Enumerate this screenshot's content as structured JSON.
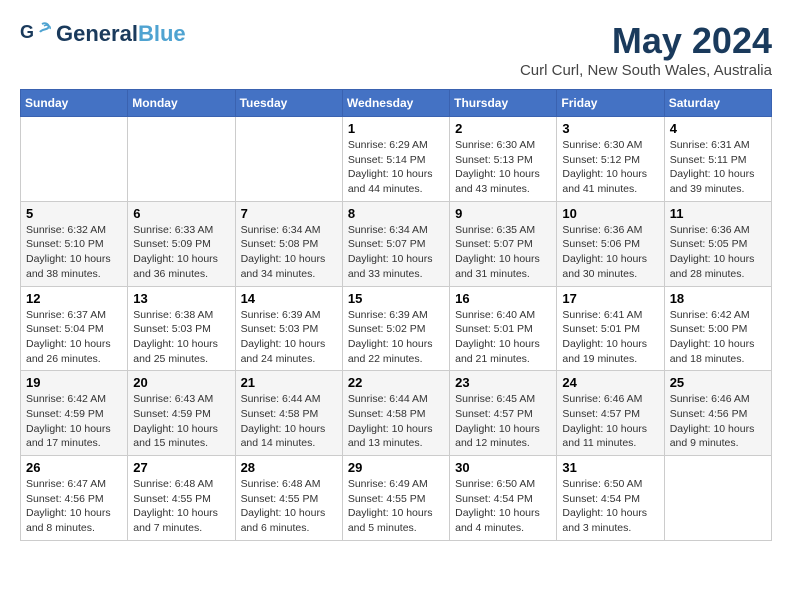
{
  "header": {
    "logo_general": "General",
    "logo_blue": "Blue",
    "month_title": "May 2024",
    "location": "Curl Curl, New South Wales, Australia"
  },
  "weekdays": [
    "Sunday",
    "Monday",
    "Tuesday",
    "Wednesday",
    "Thursday",
    "Friday",
    "Saturday"
  ],
  "weeks": [
    [
      {
        "day": "",
        "info": ""
      },
      {
        "day": "",
        "info": ""
      },
      {
        "day": "",
        "info": ""
      },
      {
        "day": "1",
        "info": "Sunrise: 6:29 AM\nSunset: 5:14 PM\nDaylight: 10 hours\nand 44 minutes."
      },
      {
        "day": "2",
        "info": "Sunrise: 6:30 AM\nSunset: 5:13 PM\nDaylight: 10 hours\nand 43 minutes."
      },
      {
        "day": "3",
        "info": "Sunrise: 6:30 AM\nSunset: 5:12 PM\nDaylight: 10 hours\nand 41 minutes."
      },
      {
        "day": "4",
        "info": "Sunrise: 6:31 AM\nSunset: 5:11 PM\nDaylight: 10 hours\nand 39 minutes."
      }
    ],
    [
      {
        "day": "5",
        "info": "Sunrise: 6:32 AM\nSunset: 5:10 PM\nDaylight: 10 hours\nand 38 minutes."
      },
      {
        "day": "6",
        "info": "Sunrise: 6:33 AM\nSunset: 5:09 PM\nDaylight: 10 hours\nand 36 minutes."
      },
      {
        "day": "7",
        "info": "Sunrise: 6:34 AM\nSunset: 5:08 PM\nDaylight: 10 hours\nand 34 minutes."
      },
      {
        "day": "8",
        "info": "Sunrise: 6:34 AM\nSunset: 5:07 PM\nDaylight: 10 hours\nand 33 minutes."
      },
      {
        "day": "9",
        "info": "Sunrise: 6:35 AM\nSunset: 5:07 PM\nDaylight: 10 hours\nand 31 minutes."
      },
      {
        "day": "10",
        "info": "Sunrise: 6:36 AM\nSunset: 5:06 PM\nDaylight: 10 hours\nand 30 minutes."
      },
      {
        "day": "11",
        "info": "Sunrise: 6:36 AM\nSunset: 5:05 PM\nDaylight: 10 hours\nand 28 minutes."
      }
    ],
    [
      {
        "day": "12",
        "info": "Sunrise: 6:37 AM\nSunset: 5:04 PM\nDaylight: 10 hours\nand 26 minutes."
      },
      {
        "day": "13",
        "info": "Sunrise: 6:38 AM\nSunset: 5:03 PM\nDaylight: 10 hours\nand 25 minutes."
      },
      {
        "day": "14",
        "info": "Sunrise: 6:39 AM\nSunset: 5:03 PM\nDaylight: 10 hours\nand 24 minutes."
      },
      {
        "day": "15",
        "info": "Sunrise: 6:39 AM\nSunset: 5:02 PM\nDaylight: 10 hours\nand 22 minutes."
      },
      {
        "day": "16",
        "info": "Sunrise: 6:40 AM\nSunset: 5:01 PM\nDaylight: 10 hours\nand 21 minutes."
      },
      {
        "day": "17",
        "info": "Sunrise: 6:41 AM\nSunset: 5:01 PM\nDaylight: 10 hours\nand 19 minutes."
      },
      {
        "day": "18",
        "info": "Sunrise: 6:42 AM\nSunset: 5:00 PM\nDaylight: 10 hours\nand 18 minutes."
      }
    ],
    [
      {
        "day": "19",
        "info": "Sunrise: 6:42 AM\nSunset: 4:59 PM\nDaylight: 10 hours\nand 17 minutes."
      },
      {
        "day": "20",
        "info": "Sunrise: 6:43 AM\nSunset: 4:59 PM\nDaylight: 10 hours\nand 15 minutes."
      },
      {
        "day": "21",
        "info": "Sunrise: 6:44 AM\nSunset: 4:58 PM\nDaylight: 10 hours\nand 14 minutes."
      },
      {
        "day": "22",
        "info": "Sunrise: 6:44 AM\nSunset: 4:58 PM\nDaylight: 10 hours\nand 13 minutes."
      },
      {
        "day": "23",
        "info": "Sunrise: 6:45 AM\nSunset: 4:57 PM\nDaylight: 10 hours\nand 12 minutes."
      },
      {
        "day": "24",
        "info": "Sunrise: 6:46 AM\nSunset: 4:57 PM\nDaylight: 10 hours\nand 11 minutes."
      },
      {
        "day": "25",
        "info": "Sunrise: 6:46 AM\nSunset: 4:56 PM\nDaylight: 10 hours\nand 9 minutes."
      }
    ],
    [
      {
        "day": "26",
        "info": "Sunrise: 6:47 AM\nSunset: 4:56 PM\nDaylight: 10 hours\nand 8 minutes."
      },
      {
        "day": "27",
        "info": "Sunrise: 6:48 AM\nSunset: 4:55 PM\nDaylight: 10 hours\nand 7 minutes."
      },
      {
        "day": "28",
        "info": "Sunrise: 6:48 AM\nSunset: 4:55 PM\nDaylight: 10 hours\nand 6 minutes."
      },
      {
        "day": "29",
        "info": "Sunrise: 6:49 AM\nSunset: 4:55 PM\nDaylight: 10 hours\nand 5 minutes."
      },
      {
        "day": "30",
        "info": "Sunrise: 6:50 AM\nSunset: 4:54 PM\nDaylight: 10 hours\nand 4 minutes."
      },
      {
        "day": "31",
        "info": "Sunrise: 6:50 AM\nSunset: 4:54 PM\nDaylight: 10 hours\nand 3 minutes."
      },
      {
        "day": "",
        "info": ""
      }
    ]
  ]
}
